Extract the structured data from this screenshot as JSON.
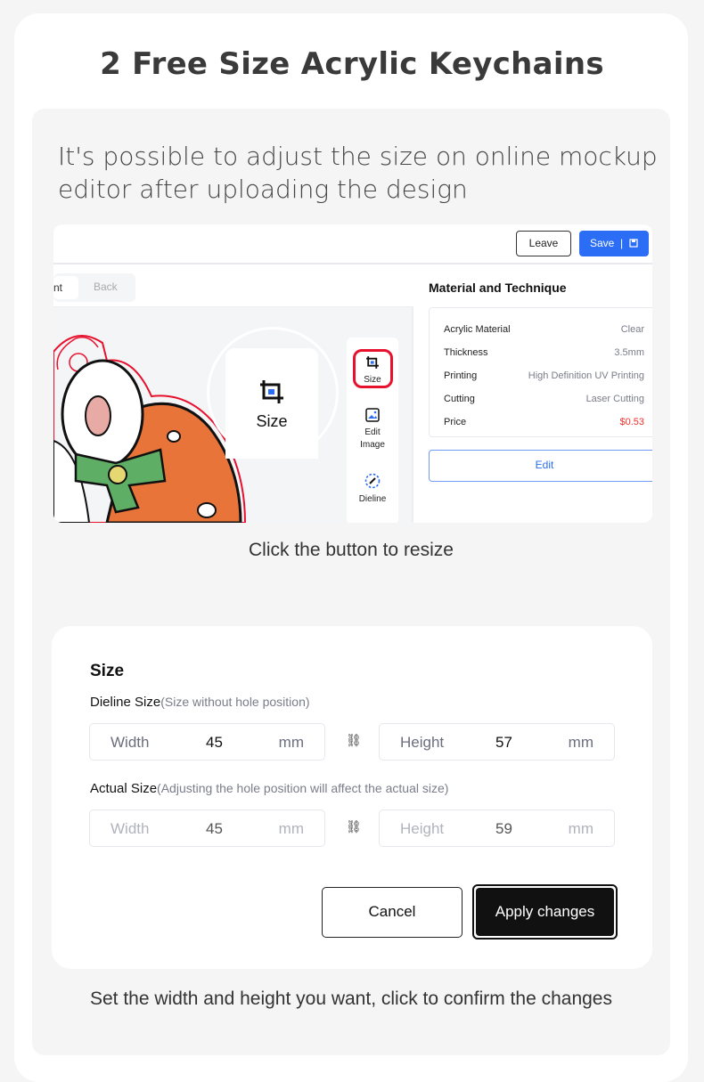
{
  "title": "2 Free Size Acrylic Keychains",
  "intro": "It's possible to adjust the size on online mockup editor after uploading the design",
  "editor": {
    "leave_label": "Leave",
    "save_label": "Save  |",
    "save_icon": "floppy-disk-icon",
    "segment": [
      "nt",
      "Back"
    ],
    "zoom_label": "Size",
    "tools": [
      {
        "label": "Size",
        "icon": "crop-icon",
        "highlight_color": "#e8112d"
      },
      {
        "label": "Edit\nImage",
        "icon": "image-icon"
      },
      {
        "label": "Dieline",
        "icon": "dieline-icon"
      }
    ],
    "material_title": "Material and Technique",
    "rows": [
      {
        "label": "Acrylic Material",
        "value": "Clear"
      },
      {
        "label": "Thickness",
        "value": "3.5mm"
      },
      {
        "label": "Printing",
        "value": "High Definition UV Printing"
      },
      {
        "label": "Cutting",
        "value": "Laser Cutting"
      },
      {
        "label": "Price",
        "value": "$0.53"
      }
    ],
    "price_color": "#f0312c",
    "accent": "#2b6ef5",
    "edit_label": "Edit"
  },
  "caption1": "Click the button to resize",
  "size_dialog": {
    "title": "Size",
    "dieline_label": "Dieline Size",
    "dieline_hint": "(Size without hole position)",
    "dieline": {
      "width_label": "Width",
      "width": "45",
      "height_label": "Height",
      "height": "57",
      "unit": "mm"
    },
    "actual_label": "Actual Size",
    "actual_hint": "(Adjusting the hole position will affect the actual size)",
    "actual": {
      "width_label": "Width",
      "width": "45",
      "height_label": "Height",
      "height": "59",
      "unit": "mm"
    },
    "cancel_label": "Cancel",
    "apply_label": "Apply changes"
  },
  "caption2": "Set the width and height you want, click to confirm the changes"
}
